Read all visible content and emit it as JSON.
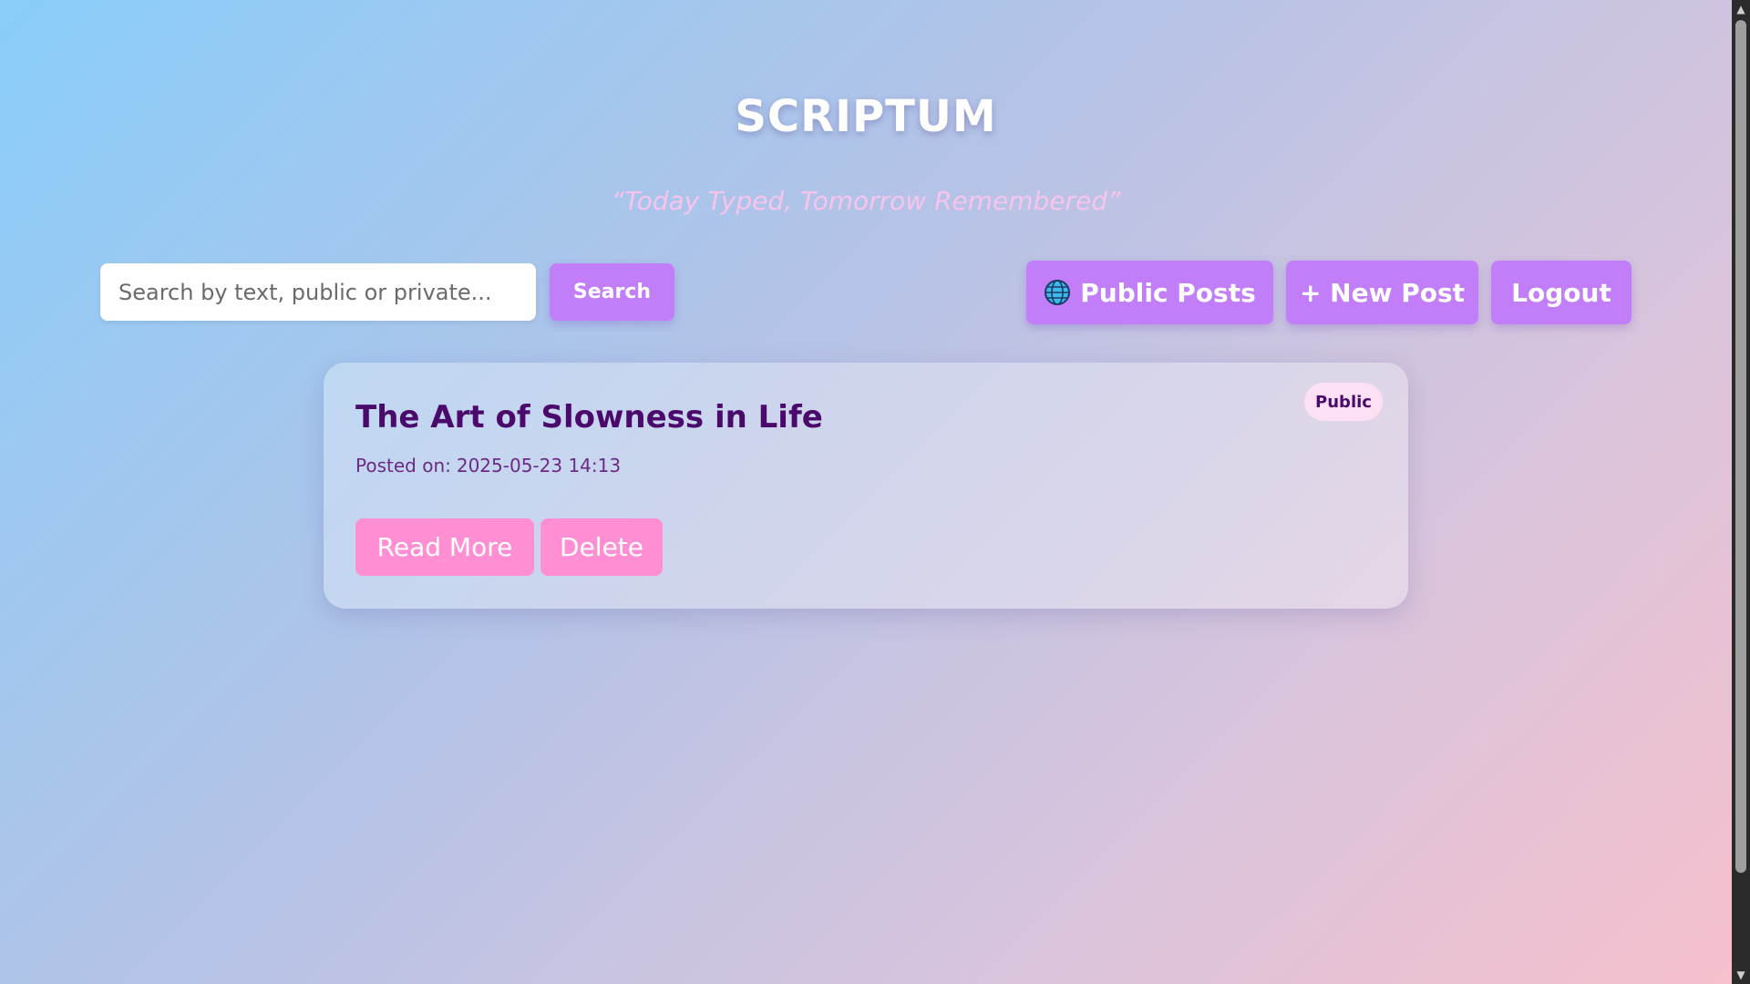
{
  "header": {
    "title": "SCRIPTUM",
    "tagline": "“Today Typed, Tomorrow Remembered”"
  },
  "toolbar": {
    "search_placeholder": "Search by text, public or private...",
    "search_label": "Search",
    "public_posts_label": "Public Posts",
    "public_posts_icon": "globe-icon",
    "new_post_label": "+ New Post",
    "logout_label": "Logout"
  },
  "posts": [
    {
      "title": "The Art of Slowness in Life",
      "posted_prefix": "Posted on:",
      "posted_at": "2025-05-23 14:13",
      "visibility": "Public",
      "read_more_label": "Read More",
      "delete_label": "Delete"
    }
  ],
  "colors": {
    "accent_purple": "#c17ef8",
    "accent_pink": "#ff8fd2",
    "title_text": "#4b0a6b",
    "badge_bg": "#fde0f3"
  }
}
